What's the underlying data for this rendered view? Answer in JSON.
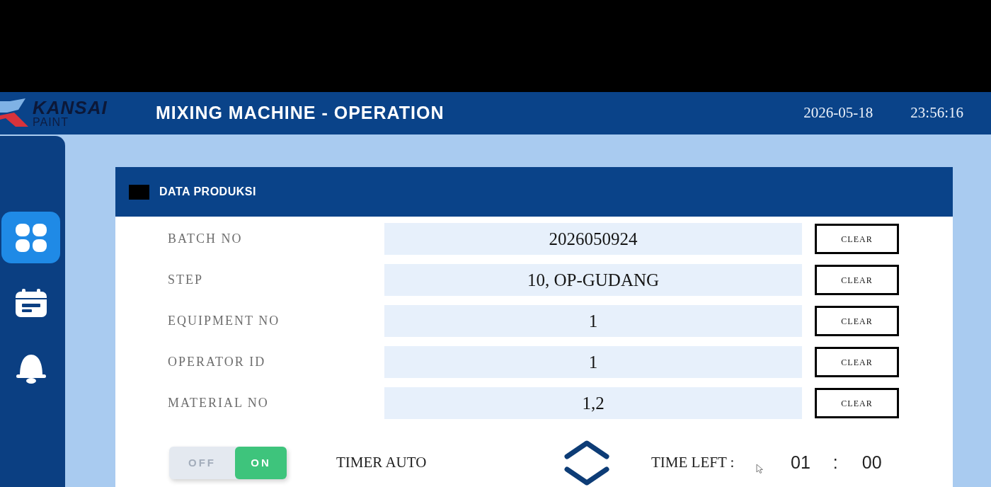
{
  "header": {
    "logo": {
      "name": "KANSAI",
      "subtitle": "PAINT"
    },
    "title": "MIXING MACHINE - OPERATION",
    "date": "2026-05-18",
    "time": "23:56:16"
  },
  "sidebar": {
    "items": [
      {
        "kind": "grid",
        "selected": true
      },
      {
        "kind": "calendar",
        "selected": false
      },
      {
        "kind": "bell",
        "selected": false
      }
    ]
  },
  "panel": {
    "title": "DATA PRODUKSI",
    "fields": [
      {
        "label": "BATCH NO",
        "value": "2026050924",
        "button": "CLEAR"
      },
      {
        "label": "STEP",
        "value": "10, OP-GUDANG",
        "button": "CLEAR"
      },
      {
        "label": "EQUIPMENT NO",
        "value": "1",
        "button": "CLEAR"
      },
      {
        "label": "OPERATOR ID",
        "value": "1",
        "button": "CLEAR"
      },
      {
        "label": "MATERIAL NO",
        "value": "1,2",
        "button": "CLEAR"
      }
    ],
    "timer": {
      "toggle": {
        "off_label": "OFF",
        "on_label": "ON",
        "on": true
      },
      "label": "TIMER AUTO",
      "time_left_label": "TIME LEFT :",
      "minutes": "01",
      "separator": ":",
      "seconds": "00"
    }
  }
}
